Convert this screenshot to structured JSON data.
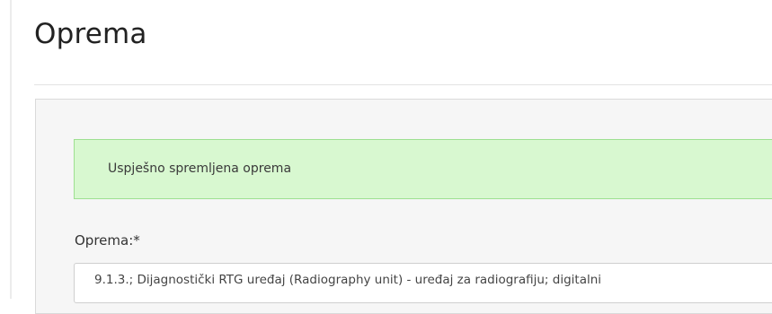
{
  "page": {
    "title": "Oprema"
  },
  "alert": {
    "message": "Uspješno spremljena oprema",
    "colors": {
      "background": "#d8f8d0",
      "border": "#9ee091"
    }
  },
  "form": {
    "equipment_label": "Oprema:*",
    "equipment_value": "9.1.3.; Dijagnostički RTG uređaj (Radiography unit) - uređaj za radiografiju; digitalni"
  }
}
